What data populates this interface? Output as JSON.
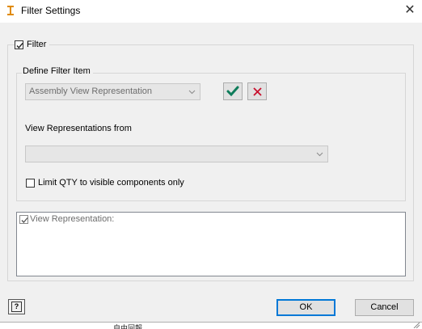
{
  "window": {
    "title": "Filter Settings",
    "close_glyph": "✕"
  },
  "filter": {
    "label": "Filter",
    "checked": true
  },
  "define": {
    "legend": "Define Filter Item",
    "item_combo_value": "Assembly View Representation",
    "views_from_label": "View Representations from",
    "views_combo_value": "",
    "limit_label": "Limit QTY to visible components only",
    "limit_checked": false
  },
  "view_rep": {
    "label": "View Representation:",
    "checked": true
  },
  "buttons": {
    "help": "?",
    "ok": "OK",
    "cancel": "Cancel"
  },
  "background_text": "自由回報",
  "colors": {
    "accent_check": "#0e7c5a",
    "accent_x": "#c8102e",
    "app_icon": "#e08a00",
    "ok_focus": "#0078d7"
  },
  "icons": [
    "app-icon",
    "close-icon",
    "checkmark-icon",
    "x-icon",
    "chevron-down-icon",
    "help-icon"
  ]
}
